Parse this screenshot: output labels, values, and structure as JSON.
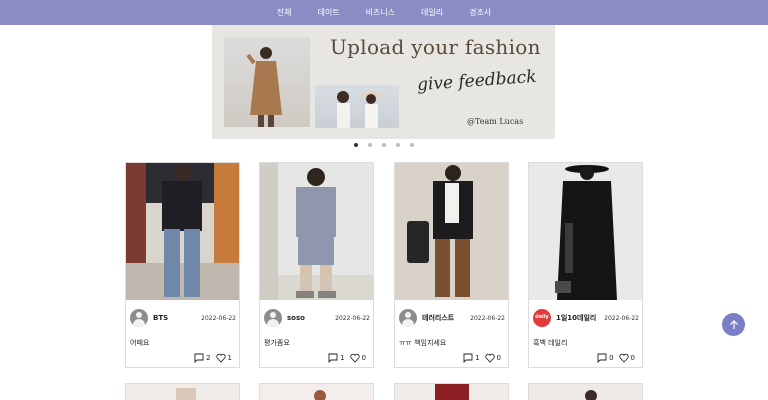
{
  "nav": [
    "전체",
    "데이트",
    "비즈니스",
    "데일리",
    "경조사"
  ],
  "banner": {
    "title": "Upload your fashion",
    "script": "give feedback",
    "team": "@Team Lucas"
  },
  "carousel": {
    "count": 5,
    "active": 0
  },
  "posts": [
    {
      "author": "BTS",
      "date": "2022-06-22",
      "caption": "어때요",
      "comments": "2",
      "likes": "1",
      "avatar": "default"
    },
    {
      "author": "soso",
      "date": "2022-06-22",
      "caption": "평가좀요",
      "comments": "1",
      "likes": "0",
      "avatar": "default"
    },
    {
      "author": "테러리스트",
      "date": "2022-06-22",
      "caption": "ㅠㅠ 책임지세요",
      "comments": "1",
      "likes": "0",
      "avatar": "default"
    },
    {
      "author": "1일10데일리",
      "date": "2022-06-22",
      "caption": "흑백 데일리",
      "comments": "0",
      "likes": "0",
      "avatar": "daily",
      "avatar_text": "daily"
    }
  ],
  "icons": {
    "comment": "comment-icon",
    "like": "heart-icon",
    "top": "arrow-up-icon"
  },
  "colors": {
    "nav": "#8a8cc4",
    "fab": "#7a7fc7",
    "daily_badge": "#e23a3a"
  }
}
